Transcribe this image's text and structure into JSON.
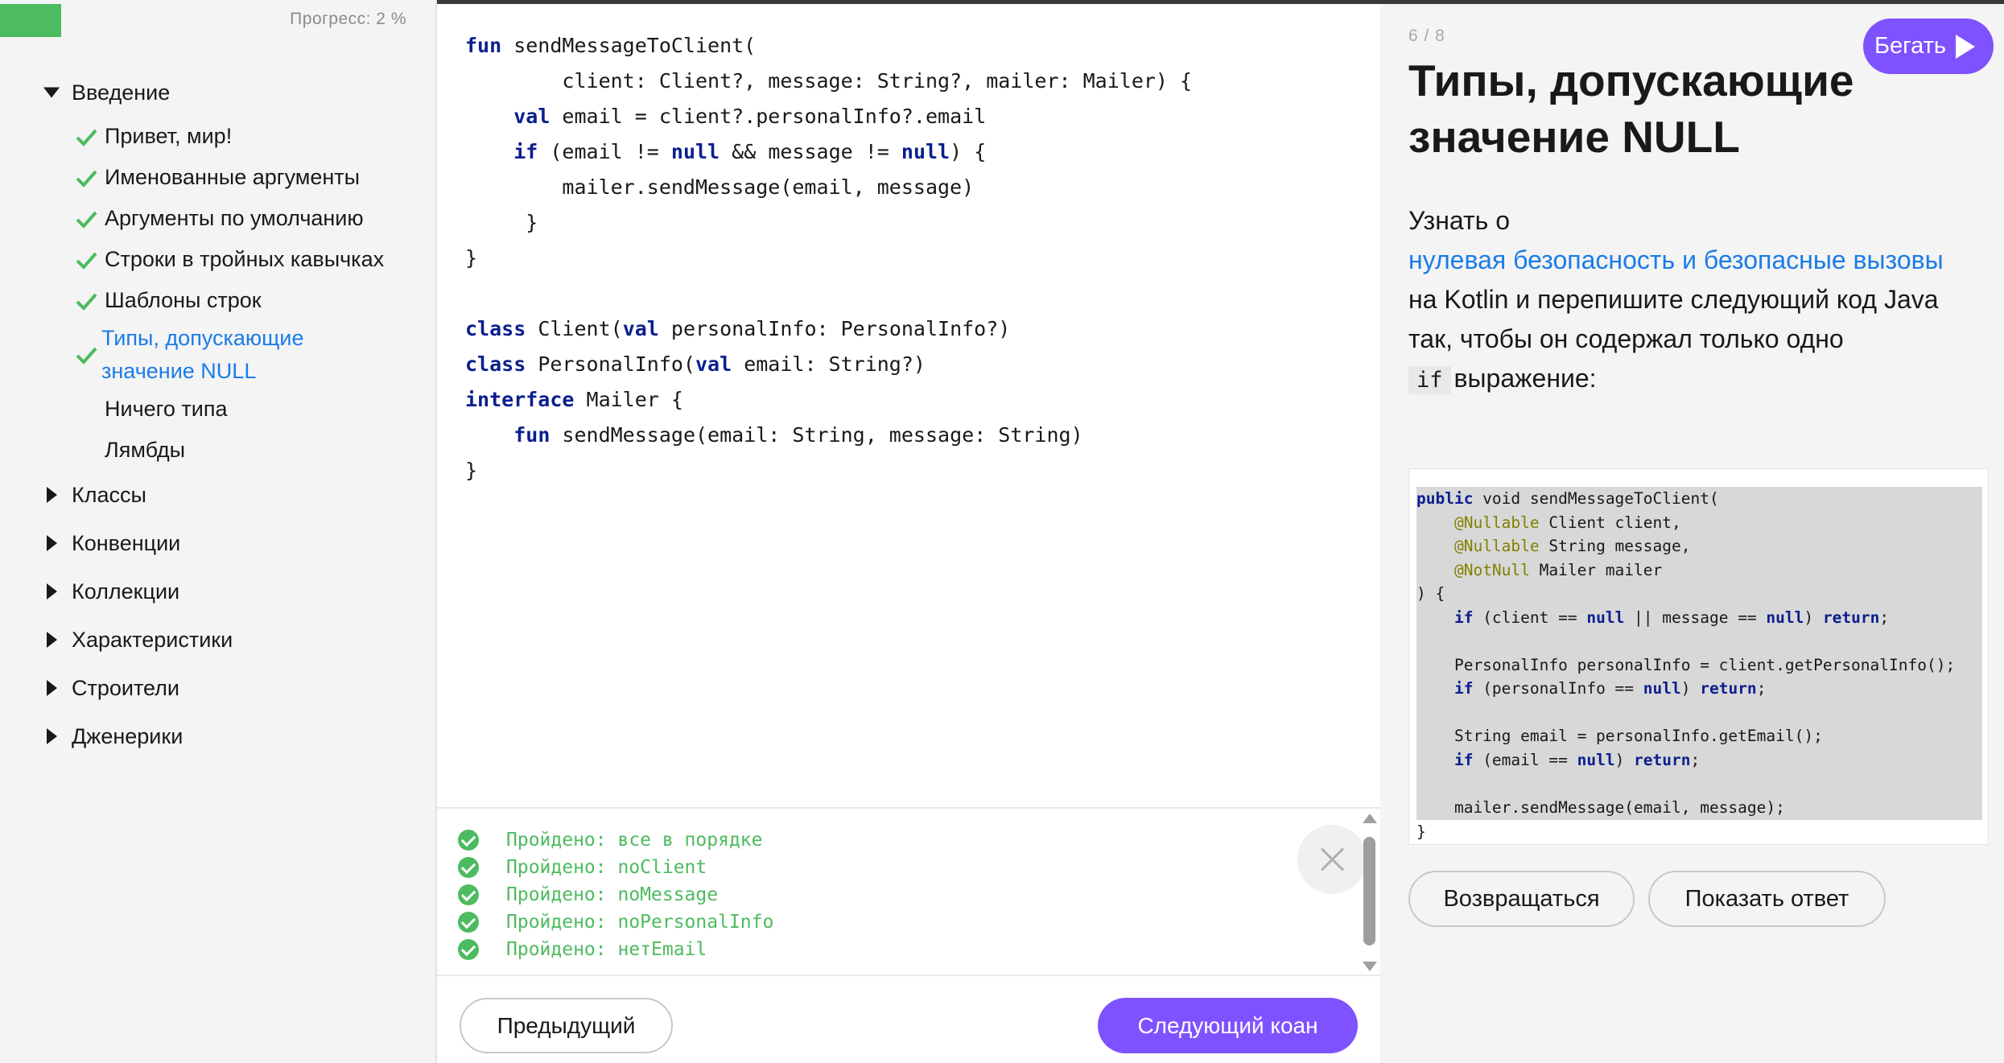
{
  "progress": {
    "label": "Прогресс: 2 %",
    "value_percent": 2
  },
  "sidebar": {
    "sections": [
      {
        "label": "Введение",
        "expanded": true
      },
      {
        "label": "Классы",
        "expanded": false
      },
      {
        "label": "Конвенции",
        "expanded": false
      },
      {
        "label": "Коллекции",
        "expanded": false
      },
      {
        "label": "Характеристики",
        "expanded": false
      },
      {
        "label": "Строители",
        "expanded": false
      },
      {
        "label": "Дженерики",
        "expanded": false
      }
    ],
    "lessons": [
      {
        "label": "Привет, мир!",
        "completed": true
      },
      {
        "label": "Именованные аргументы",
        "completed": true
      },
      {
        "label": "Аргументы по умолчанию",
        "completed": true
      },
      {
        "label": "Строки в тройных кавычках",
        "completed": true
      },
      {
        "label": "Шаблоны строк",
        "completed": true
      },
      {
        "label": "Типы, допускающие значение NULL",
        "completed": true,
        "active": true
      },
      {
        "label": "Ничего типа",
        "completed": false
      },
      {
        "label": "Лямбды",
        "completed": false
      }
    ]
  },
  "editor": {
    "lines": [
      [
        [
          "kw",
          "fun"
        ],
        [
          "t",
          " sendMessageToClient("
        ]
      ],
      [
        [
          "t",
          "        client: Client?, message: String?, mailer: Mailer) {"
        ]
      ],
      [
        [
          "t",
          "    "
        ],
        [
          "kw",
          "val"
        ],
        [
          "t",
          " email = client?.personalInfo?.email"
        ]
      ],
      [
        [
          "t",
          "    "
        ],
        [
          "kw",
          "if"
        ],
        [
          "t",
          " (email != "
        ],
        [
          "kw",
          "null"
        ],
        [
          "t",
          " && message != "
        ],
        [
          "kw",
          "null"
        ],
        [
          "t",
          ") {"
        ]
      ],
      [
        [
          "t",
          "        mailer.sendMessage(email, message)"
        ]
      ],
      [
        [
          "t",
          "     }"
        ]
      ],
      [
        [
          "t",
          "}"
        ]
      ],
      [
        [
          "t",
          ""
        ]
      ],
      [
        [
          "kw",
          "class"
        ],
        [
          "t",
          " Client("
        ],
        [
          "kw",
          "val"
        ],
        [
          "t",
          " personalInfo: PersonalInfo?)"
        ]
      ],
      [
        [
          "kw",
          "class"
        ],
        [
          "t",
          " PersonalInfo("
        ],
        [
          "kw",
          "val"
        ],
        [
          "t",
          " email: String?)"
        ]
      ],
      [
        [
          "kw",
          "interface"
        ],
        [
          "t",
          " Mailer {"
        ]
      ],
      [
        [
          "t",
          "    "
        ],
        [
          "kw",
          "fun"
        ],
        [
          "t",
          " sendMessage(email: String, message: String)"
        ]
      ],
      [
        [
          "t",
          "}"
        ]
      ]
    ]
  },
  "results": [
    "Пройдено: все в порядке",
    "Пройдено: noClient",
    "Пройдено: noMessage",
    "Пройдено: noPersonalInfo",
    "Пройдено: нетEmail"
  ],
  "nav": {
    "prev_label": "Предыдущий",
    "next_label": "Следующий коан"
  },
  "task": {
    "counter": "6 / 8",
    "run_label": "Бегать",
    "title": "Типы, допускающие значение NULL",
    "desc_prefix": "Узнать о",
    "desc_link": "нулевая безопасность и безопасные вызовы",
    "desc_middle": "на Kotlin и перепишите следующий код Java так, чтобы он содержал только одно",
    "desc_code": "if",
    "desc_suffix": "выражение:",
    "java_lines": [
      [
        [
          "jkw",
          "public"
        ],
        [
          "t",
          " void sendMessageToClient("
        ]
      ],
      [
        [
          "t",
          "    "
        ],
        [
          "jan",
          "@Nullable"
        ],
        [
          "t",
          " Client client,"
        ]
      ],
      [
        [
          "t",
          "    "
        ],
        [
          "jan",
          "@Nullable"
        ],
        [
          "t",
          " String message,"
        ]
      ],
      [
        [
          "t",
          "    "
        ],
        [
          "jan",
          "@NotNull"
        ],
        [
          "t",
          " Mailer mailer"
        ]
      ],
      [
        [
          "t",
          ") {"
        ]
      ],
      [
        [
          "t",
          "    "
        ],
        [
          "jkw",
          "if"
        ],
        [
          "t",
          " (client == "
        ],
        [
          "jkw",
          "null"
        ],
        [
          "t",
          " || message == "
        ],
        [
          "jkw",
          "null"
        ],
        [
          "t",
          ") "
        ],
        [
          "jkw",
          "return"
        ],
        [
          "t",
          ";"
        ]
      ],
      [
        [
          "t",
          ""
        ]
      ],
      [
        [
          "t",
          "    PersonalInfo personalInfo = client.getPersonalInfo();"
        ]
      ],
      [
        [
          "t",
          "    "
        ],
        [
          "jkw",
          "if"
        ],
        [
          "t",
          " (personalInfo == "
        ],
        [
          "jkw",
          "null"
        ],
        [
          "t",
          ") "
        ],
        [
          "jkw",
          "return"
        ],
        [
          "t",
          ";"
        ]
      ],
      [
        [
          "t",
          ""
        ]
      ],
      [
        [
          "t",
          "    String email = personalInfo.getEmail();"
        ]
      ],
      [
        [
          "t",
          "    "
        ],
        [
          "jkw",
          "if"
        ],
        [
          "t",
          " (email == "
        ],
        [
          "jkw",
          "null"
        ],
        [
          "t",
          ") "
        ],
        [
          "jkw",
          "return"
        ],
        [
          "t",
          ";"
        ]
      ],
      [
        [
          "t",
          ""
        ]
      ],
      [
        [
          "t",
          "    mailer.sendMessage(email, message);"
        ]
      ]
    ],
    "java_tail": "}",
    "back_label": "Возвращаться",
    "answer_label": "Показать ответ"
  },
  "colors": {
    "accent": "#7f52ff",
    "success": "#4dbb5f",
    "link": "#1a7ce8",
    "keyword": "#0b1f8f",
    "annotation": "#808000"
  }
}
